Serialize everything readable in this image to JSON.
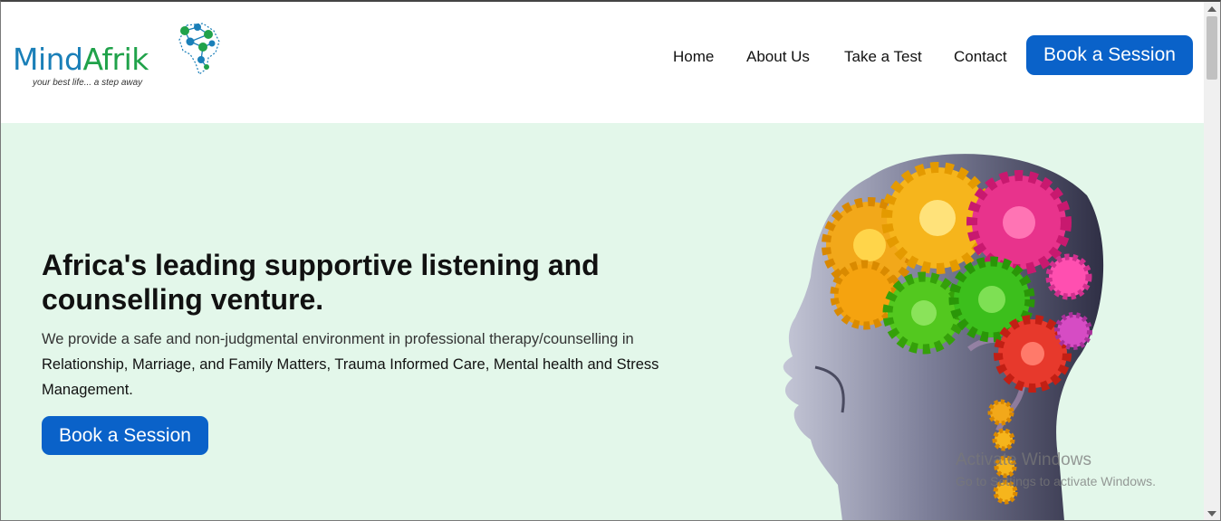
{
  "brand": {
    "name_part1": "Mind",
    "name_part2": "Afrik",
    "tagline": "your best life... a step away",
    "colors": {
      "blue": "#1a7fb8",
      "green": "#20a24a"
    }
  },
  "nav": {
    "items": [
      {
        "label": "Home"
      },
      {
        "label": "About Us"
      },
      {
        "label": "Take a Test"
      },
      {
        "label": "Contact"
      }
    ],
    "cta_label": "Book a Session"
  },
  "hero": {
    "headline": "Africa's leading supportive listening and counselling venture.",
    "desc_intro": "We provide a safe and non-judgmental environment in professional therapy/counselling in ",
    "desc_highlight": "Relationship, Marriage, and Family Matters, Trauma Informed Care, Mental health and Stress Management.",
    "cta_label": "Book a Session",
    "background": "#e3f7ea",
    "image_icon": "brain-gears-head-icon"
  },
  "accent_color": "#0a62c9",
  "watermark": {
    "title": "Activate Windows",
    "subtitle": "Go to Settings to activate Windows."
  }
}
